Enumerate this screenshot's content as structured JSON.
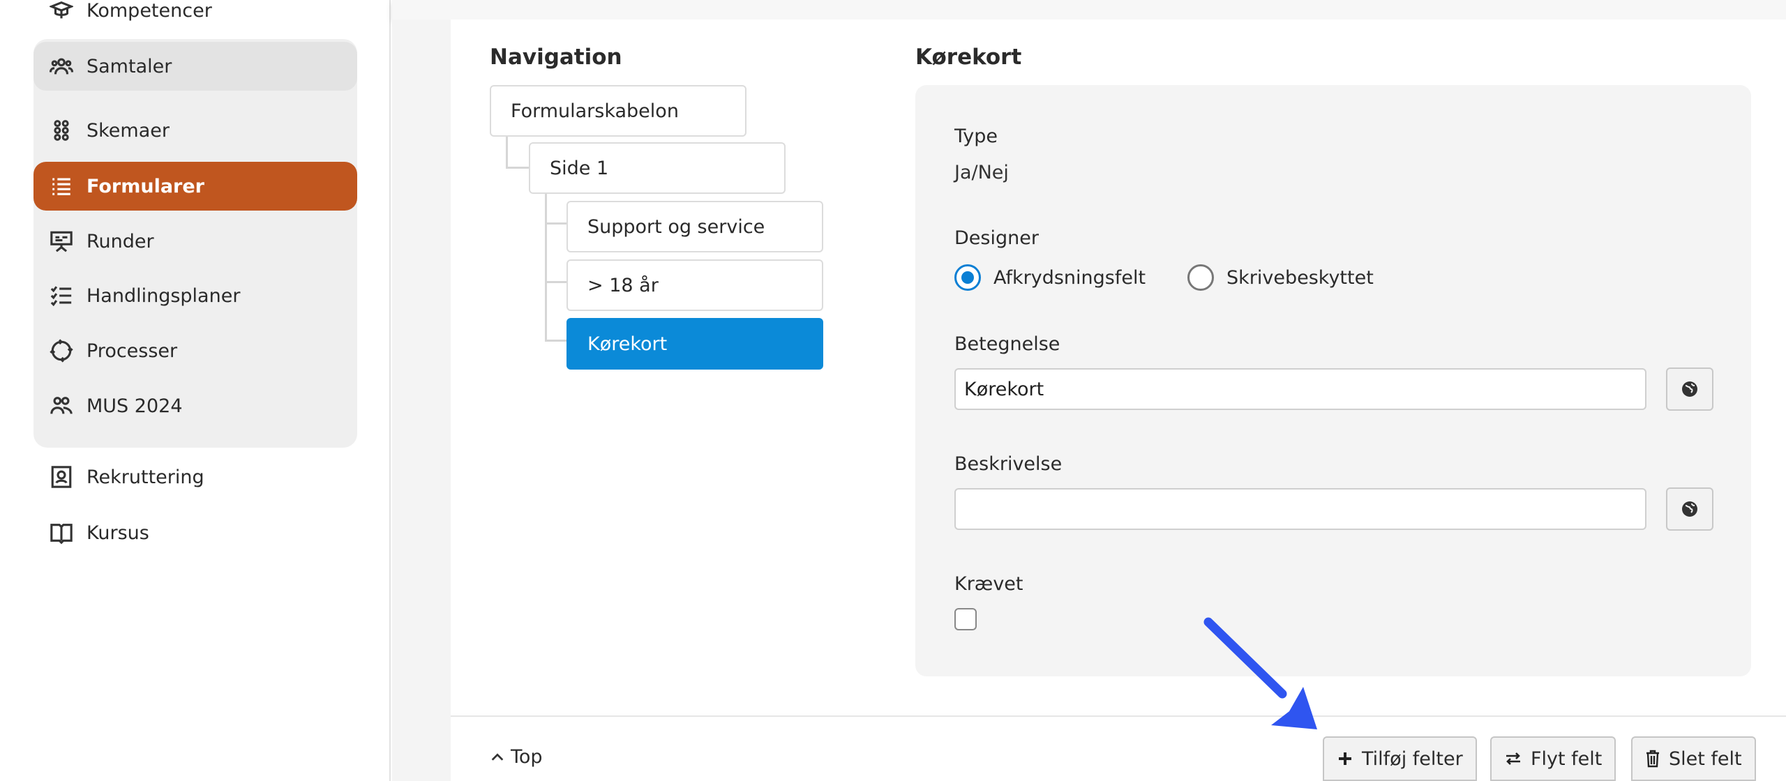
{
  "sidebar": {
    "items": [
      {
        "label": "Kompetencer",
        "icon": "graduation-cap-icon"
      },
      {
        "label": "Samtaler",
        "icon": "people-group-icon"
      },
      {
        "label": "Skemaer",
        "icon": "grid-dots-icon"
      },
      {
        "label": "Formularer",
        "icon": "list-icon"
      },
      {
        "label": "Runder",
        "icon": "presentation-board-icon"
      },
      {
        "label": "Handlingsplaner",
        "icon": "checklist-icon"
      },
      {
        "label": "Processer",
        "icon": "cycle-arrows-icon"
      },
      {
        "label": "MUS 2024",
        "icon": "people-pair-icon"
      },
      {
        "label": "Rekruttering",
        "icon": "id-badge-icon"
      },
      {
        "label": "Kursus",
        "icon": "open-book-icon"
      }
    ]
  },
  "navigation": {
    "heading": "Navigation",
    "nodes": [
      {
        "label": "Formularskabelon"
      },
      {
        "label": "Side 1"
      },
      {
        "label": "Support og service"
      },
      {
        "label": "> 18 år"
      },
      {
        "label": "Kørekort"
      }
    ]
  },
  "details": {
    "heading": "Kørekort",
    "type_label": "Type",
    "type_value": "Ja/Nej",
    "designer_label": "Designer",
    "designer_options": [
      {
        "label": "Afkrydsningsfelt",
        "selected": true
      },
      {
        "label": "Skrivebeskyttet",
        "selected": false
      }
    ],
    "betegnelse_label": "Betegnelse",
    "betegnelse_value": "Kørekort",
    "beskrivelse_label": "Beskrivelse",
    "beskrivelse_value": "",
    "kraevet_label": "Krævet",
    "kraevet_checked": false
  },
  "footer": {
    "top_label": "Top",
    "buttons": [
      {
        "label": "Tilføj felter",
        "icon": "plus-icon"
      },
      {
        "label": "Flyt felt",
        "icon": "swap-arrows-icon"
      },
      {
        "label": "Slet felt",
        "icon": "trash-icon"
      }
    ]
  },
  "colors": {
    "active_nav": "#c0561f",
    "selected_node": "#0b8ad8",
    "radio_on": "#0b7fd4",
    "annotation_arrow": "#2f55f0"
  }
}
